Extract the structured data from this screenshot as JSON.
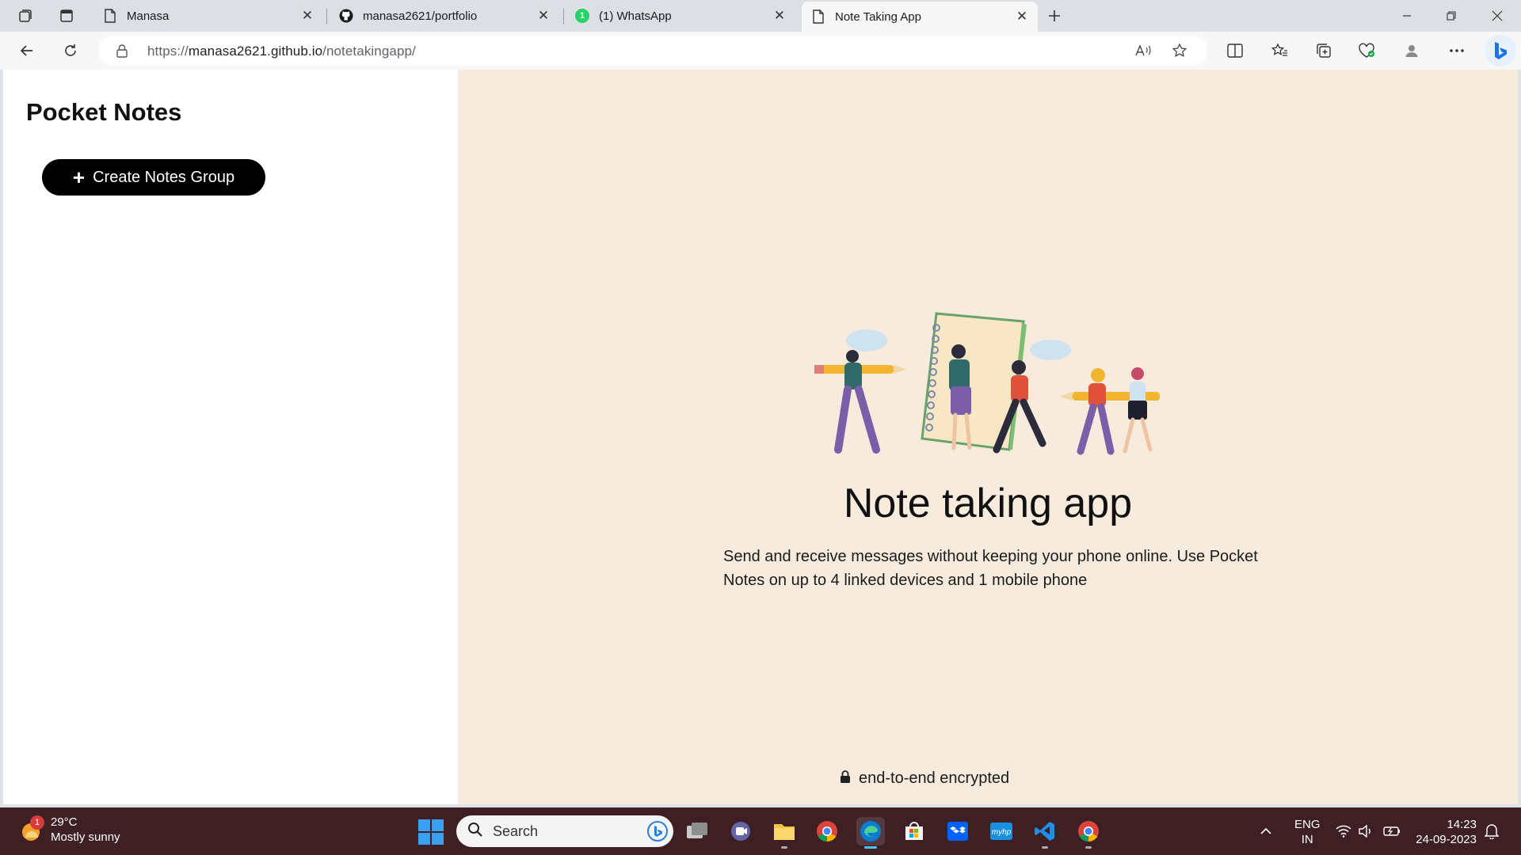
{
  "browser": {
    "tabs": [
      {
        "title": "Manasa",
        "close": "✕"
      },
      {
        "title": "manasa2621/portfolio",
        "close": "✕"
      },
      {
        "title": "(1) WhatsApp",
        "close": "✕",
        "badge": "1"
      },
      {
        "title": "Note Taking App",
        "close": "✕"
      }
    ],
    "url_prefix": "https://",
    "url_host": "manasa2621.github.io",
    "url_path": "/notetakingapp/"
  },
  "app": {
    "title": "Pocket Notes",
    "create_button": {
      "icon": "+",
      "label": "Create Notes Group"
    },
    "hero_title": "Note taking app",
    "hero_description": "Send and receive messages without keeping your phone online. Use Pocket Notes on up to 4 linked devices and 1 mobile phone",
    "encryption_note": "end-to-end encrypted"
  },
  "taskbar": {
    "weather": {
      "badge": "1",
      "temperature": "29°C",
      "condition": "Mostly sunny"
    },
    "search_placeholder": "Search",
    "language": {
      "line1": "ENG",
      "line2": "IN"
    },
    "time": "14:23",
    "date": "24-09-2023"
  },
  "colors": {
    "main_background": "#f6ebdc",
    "button_background": "#000000",
    "taskbar_background": "#3d1f24",
    "tabstrip_background": "#dcdfe4"
  }
}
